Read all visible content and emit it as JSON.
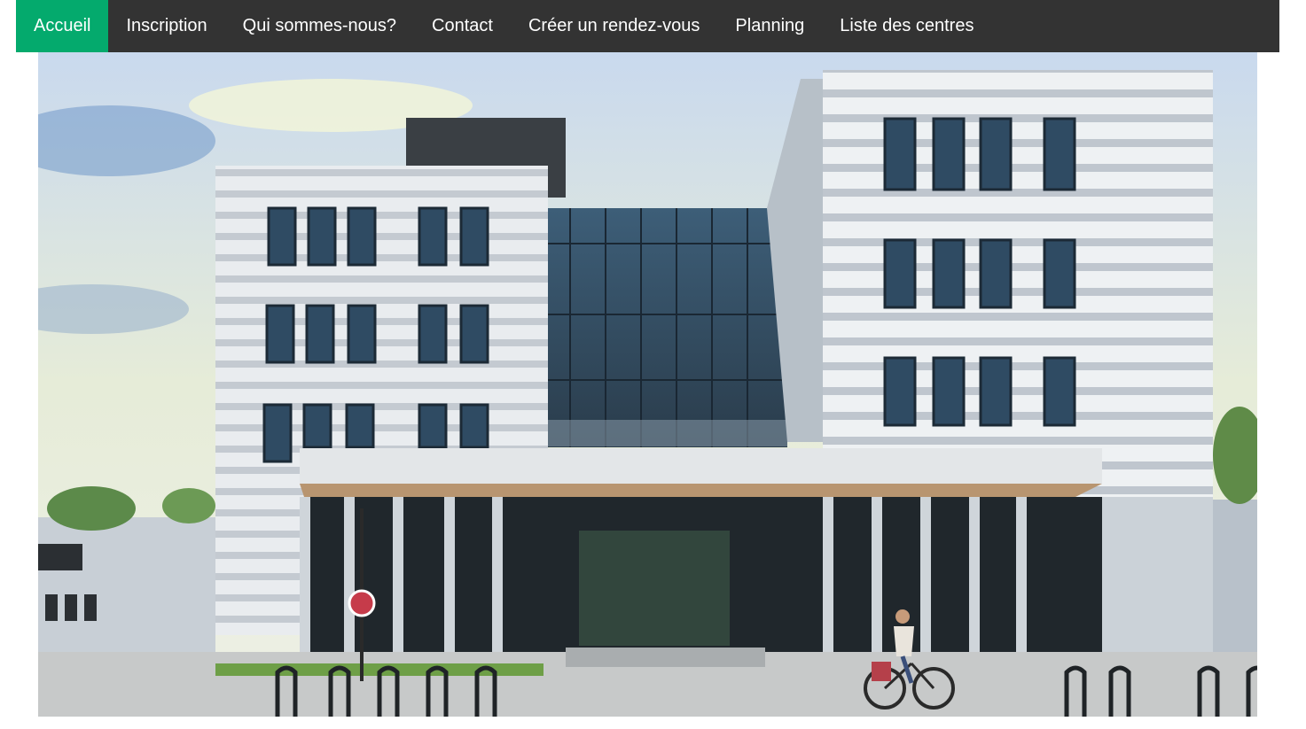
{
  "nav": {
    "items": [
      {
        "label": "Accueil",
        "active": true
      },
      {
        "label": "Inscription",
        "active": false
      },
      {
        "label": "Qui sommes-nous?",
        "active": false
      },
      {
        "label": "Contact",
        "active": false
      },
      {
        "label": "Créer un rendez-vous",
        "active": false
      },
      {
        "label": "Planning",
        "active": false
      },
      {
        "label": "Liste des centres",
        "active": false
      }
    ],
    "background_color": "#333333",
    "active_color": "#04AA6D",
    "text_color": "#ffffff"
  },
  "hero": {
    "image_subject": "modern-office-building-photo"
  }
}
